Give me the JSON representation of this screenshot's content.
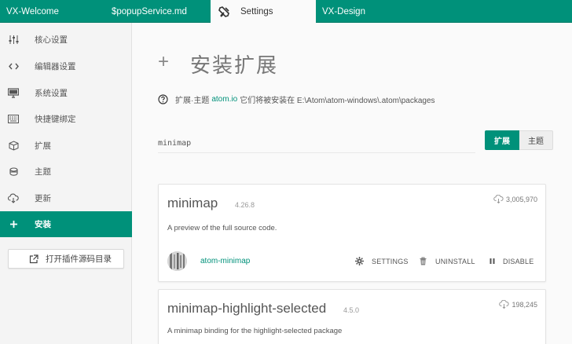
{
  "tabs": [
    {
      "label": "VX-Welcome"
    },
    {
      "label": "$popupService.md"
    },
    {
      "label": "Settings",
      "icon": "tools-icon"
    },
    {
      "label": "VX-Design"
    }
  ],
  "sidebar": {
    "items": [
      {
        "label": "核心设置",
        "icon": "sliders-icon"
      },
      {
        "label": "编辑器设置",
        "icon": "code-icon"
      },
      {
        "label": "系统设置",
        "icon": "desktop-icon"
      },
      {
        "label": "快捷键绑定",
        "icon": "keyboard-icon"
      },
      {
        "label": "扩展",
        "icon": "package-icon"
      },
      {
        "label": "主题",
        "icon": "paintcan-icon"
      },
      {
        "label": "更新",
        "icon": "cloud-download-icon"
      },
      {
        "label": "安装",
        "icon": "plus-icon"
      }
    ],
    "open_source_button": "打开插件源码目录"
  },
  "main": {
    "plus": "+",
    "title": "安装扩展",
    "info_prefix": "扩展·主题",
    "info_link": "atom.io",
    "info_suffix": "它们将被安装在 E:\\Atom\\atom-windows\\.atom\\packages",
    "search_value": "minimap",
    "toggle": {
      "packages": "扩展",
      "themes": "主题"
    }
  },
  "packages": [
    {
      "name": "minimap",
      "version": "4.26.8",
      "downloads": "3,005,970",
      "description": "A preview of the full source code.",
      "author": "atom-minimap",
      "actions": {
        "settings": "SETTINGS",
        "uninstall": "UNINSTALL",
        "disable": "DISABLE"
      }
    },
    {
      "name": "minimap-highlight-selected",
      "version": "4.5.0",
      "downloads": "198,245",
      "description": "A minimap binding for the highlight-selected package"
    }
  ],
  "colors": {
    "accent": "#00917a",
    "sidebar_bg": "#f4f4f4",
    "main_bg": "#fafafa"
  }
}
